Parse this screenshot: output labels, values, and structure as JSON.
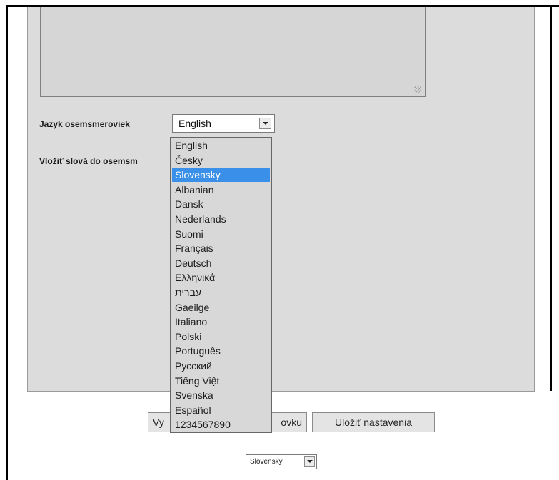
{
  "language_label": "Jazyk osemsmeroviek",
  "insert_words_label": "Vložiť slová do osemsm",
  "language_select": {
    "value": "English"
  },
  "language_options": [
    "English",
    "Česky",
    "Slovensky",
    "Albanian",
    "Dansk",
    "Nederlands",
    "Suomi",
    "Français",
    "Deutsch",
    "Ελληνικά",
    "עברית",
    "Gaeilge",
    "Italiano",
    "Polski",
    "Português",
    "Русский",
    "Tiếng Việt",
    "Svenska",
    "Español",
    "1234567890"
  ],
  "selected_option": "Slovensky",
  "buttons": {
    "generate_left": "Vy",
    "generate_right": "ovku",
    "save_settings": "Uložiť nastavenia"
  },
  "ui_language_select": {
    "value": "Slovensky"
  }
}
